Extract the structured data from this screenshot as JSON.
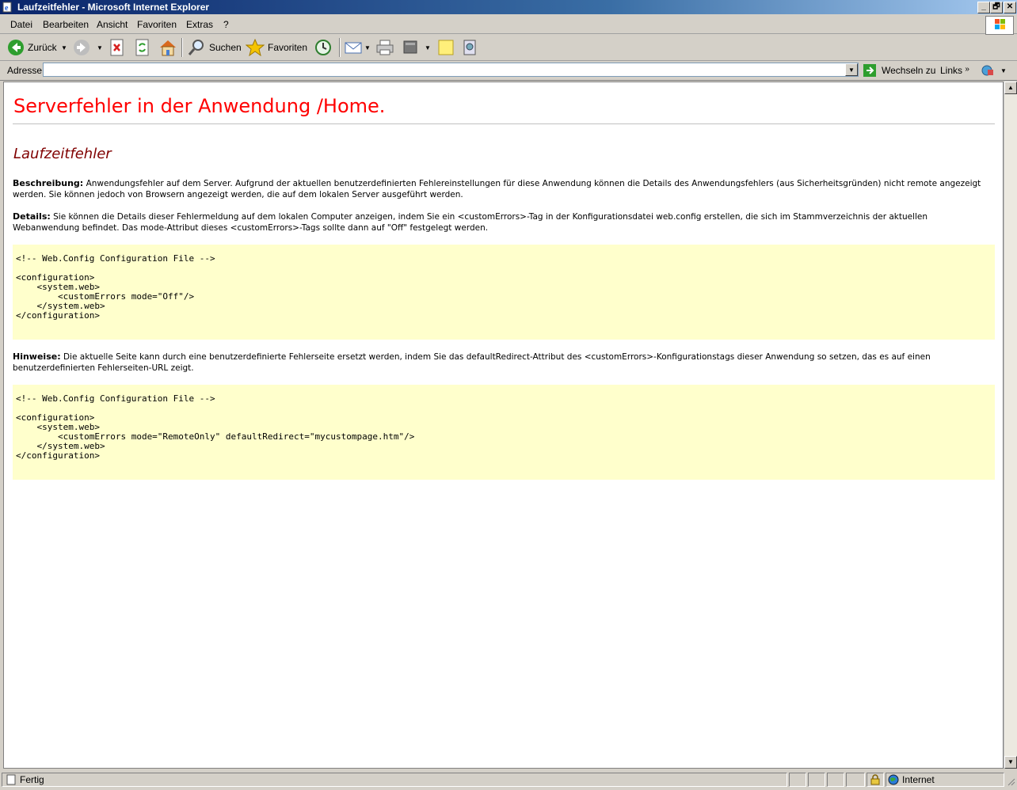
{
  "window": {
    "title": "Laufzeitfehler - Microsoft Internet Explorer",
    "controls": [
      "_",
      "🗗",
      "✕"
    ]
  },
  "menu": [
    "Datei",
    "Bearbeiten",
    "Ansicht",
    "Favoriten",
    "Extras",
    "?"
  ],
  "toolbar": {
    "back_label": "Zurück",
    "search_label": "Suchen",
    "favorites_label": "Favoriten"
  },
  "address": {
    "label": "Adresse",
    "value": "",
    "go_label": "Wechseln zu",
    "links_label": "Links"
  },
  "page": {
    "heading": "Serverfehler in der Anwendung /Home.",
    "subheading": "Laufzeitfehler",
    "description_label": "Beschreibung:",
    "description_text": "Anwendungsfehler auf dem Server. Aufgrund der aktuellen benutzerdefinierten Fehlereinstellungen für diese Anwendung können die Details des Anwendungsfehlers (aus Sicherheitsgründen) nicht remote angezeigt werden. Sie können jedoch von Browsern angezeigt werden, die auf dem lokalen Server ausgeführt werden.",
    "details_label": "Details:",
    "details_text": "Sie können die Details dieser Fehlermeldung auf dem lokalen Computer anzeigen, indem Sie ein <customErrors>-Tag in der Konfigurationsdatei web.config erstellen, die sich im Stammverzeichnis der aktuellen Webanwendung befindet. Das mode-Attribut dieses <customErrors>-Tags sollte dann auf \"Off\" festgelegt werden.",
    "code1": "<!-- Web.Config Configuration File -->\n\n<configuration>\n    <system.web>\n        <customErrors mode=\"Off\"/>\n    </system.web>\n</configuration>",
    "notes_label": "Hinweise:",
    "notes_text": "Die aktuelle Seite kann durch eine benutzerdefinierte Fehlerseite ersetzt werden, indem Sie das defaultRedirect-Attribut des <customErrors>-Konfigurationstags dieser Anwendung so setzen, das es auf einen benutzerdefinierten Fehlerseiten-URL zeigt.",
    "code2": "<!-- Web.Config Configuration File -->\n\n<configuration>\n    <system.web>\n        <customErrors mode=\"RemoteOnly\" defaultRedirect=\"mycustompage.htm\"/>\n    </system.web>\n</configuration>"
  },
  "status": {
    "text": "Fertig",
    "zone": "Internet"
  },
  "colors": {
    "heading": "#ff0000",
    "subheading": "#800000",
    "code_bg": "#ffffcc"
  }
}
